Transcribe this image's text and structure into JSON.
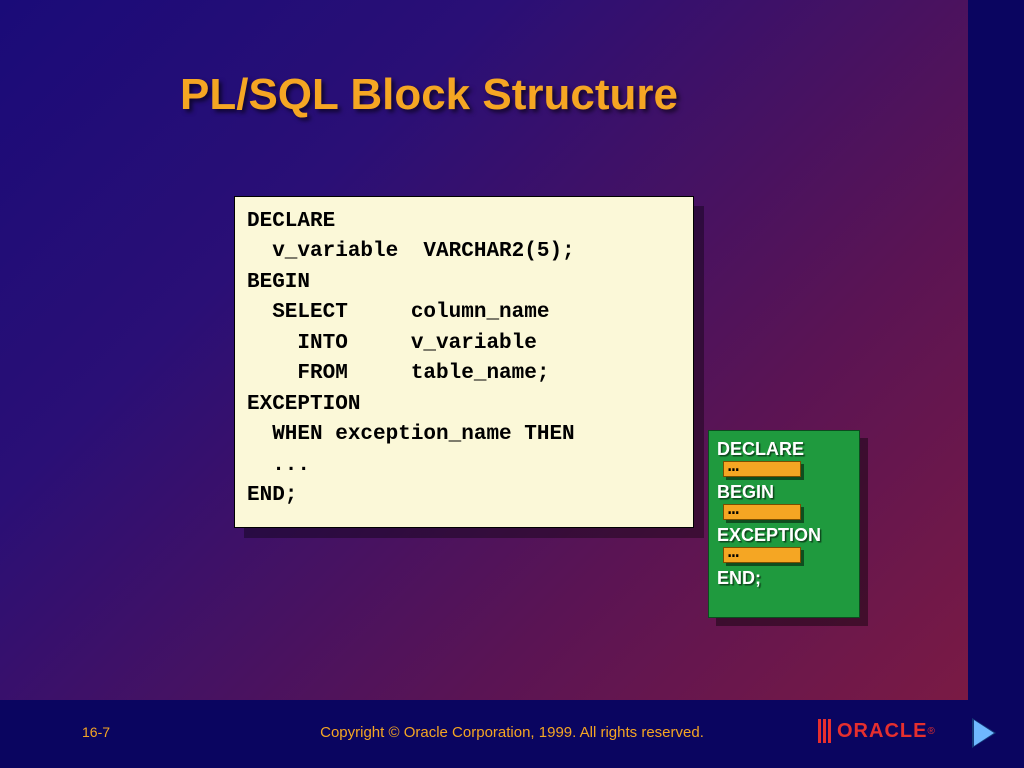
{
  "title": "PL/SQL Block Structure",
  "code": "DECLARE\n  v_variable  VARCHAR2(5);\nBEGIN\n  SELECT     column_name\n    INTO     v_variable\n    FROM     table_name;\nEXCEPTION\n  WHEN exception_name THEN\n  ...\nEND;",
  "mini": {
    "kw1": "DECLARE",
    "kw2": "BEGIN",
    "kw3": "EXCEPTION",
    "kw4": "END;",
    "dots": "…"
  },
  "page_num": "16-7",
  "copyright": "Copyright © Oracle Corporation, 1999. All rights reserved.",
  "logo_text": "ORACLE",
  "logo_reg": "®"
}
